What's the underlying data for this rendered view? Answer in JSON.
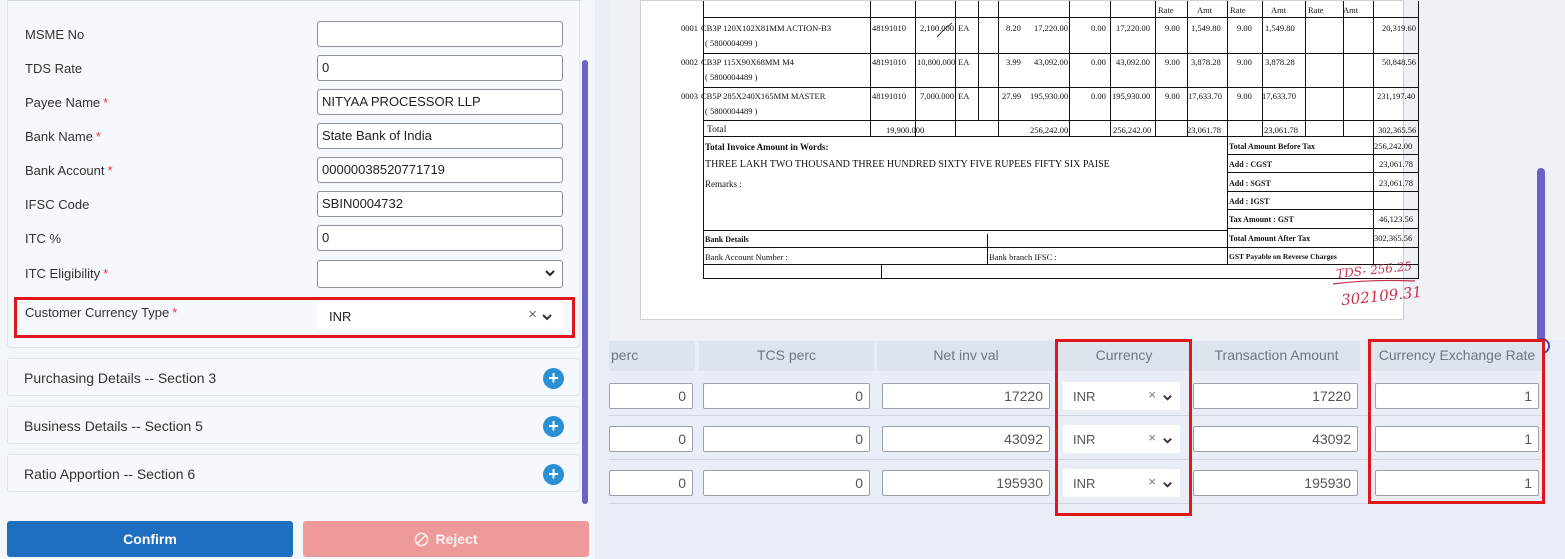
{
  "form": {
    "fields": [
      {
        "label": "MSME No",
        "value": "",
        "required": false
      },
      {
        "label": "TDS Rate",
        "value": "0",
        "required": false
      },
      {
        "label": "Payee Name",
        "value": "NITYAA PROCESSOR LLP",
        "required": true
      },
      {
        "label": "Bank Name",
        "value": "State Bank of India",
        "required": true
      },
      {
        "label": "Bank Account",
        "value": "00000038520771719",
        "required": true
      },
      {
        "label": "IFSC Code",
        "value": "SBIN0004732",
        "required": false
      },
      {
        "label": "ITC %",
        "value": "0",
        "required": false
      },
      {
        "label": "ITC Eligibility",
        "value": "",
        "required": true
      }
    ],
    "currency_type": {
      "label": "Customer Currency Type",
      "value": "INR",
      "clear": "×"
    },
    "required_mark": "*"
  },
  "sections": [
    {
      "title": "Purchasing Details -- Section 3"
    },
    {
      "title": "Business Details -- Section 5"
    },
    {
      "title": "Ratio Apportion -- Section 6"
    }
  ],
  "actions": {
    "confirm": "Confirm",
    "reject": "Reject"
  },
  "invoice": {
    "header_cols": [
      "Rate",
      "Amt",
      "Rate",
      "Amt",
      "Rate",
      "Amt"
    ],
    "lines": [
      {
        "sno": "0001",
        "desc": "CB3P 120X102X81MM ACTION-B3",
        "code": "( 5800004099 )",
        "hsn": "48191010",
        "qty": "2,100.000",
        "unit": "EA",
        "rate": "8.20",
        "amount": "17,220.00",
        "disc": "0.00",
        "taxable": "17,220.00",
        "cgst_rate": "9.00",
        "cgst_amt": "1,549.80",
        "sgst_rate": "9.00",
        "sgst_amt": "1,549.80",
        "total": "20,319.60"
      },
      {
        "sno": "0002",
        "desc": "CB3P 115X90X68MM M4",
        "code": "( 5800004489 )",
        "hsn": "48191010",
        "qty": "10,800.000",
        "unit": "EA",
        "rate": "3.99",
        "amount": "43,092.00",
        "disc": "0.00",
        "taxable": "43,092.00",
        "cgst_rate": "9.00",
        "cgst_amt": "3,878.28",
        "sgst_rate": "9.00",
        "sgst_amt": "3,878.28",
        "total": "50,848.56"
      },
      {
        "sno": "0003",
        "desc": "CB5P 285X240X165MM MASTER",
        "code": "( 5800004489 )",
        "hsn": "48191010",
        "qty": "7,000.000",
        "unit": "EA",
        "rate": "27.99",
        "amount": "195,930.00",
        "disc": "0.00",
        "taxable": "195,930.00",
        "cgst_rate": "9.00",
        "cgst_amt": "17,633.70",
        "sgst_rate": "9.00",
        "sgst_amt": "17,633.70",
        "total": "231,197.40"
      }
    ],
    "total_row": {
      "label": "Total",
      "qty": "19,900.000",
      "amount": "256,242.00",
      "taxable": "256,242.00",
      "cgst_amt": "23,061.78",
      "sgst_amt": "23,061.78",
      "total": "302,365.56"
    },
    "words_label": "Total Invoice Amount in Words:",
    "words_value": "THREE LAKH TWO THOUSAND THREE HUNDRED SIXTY FIVE RUPEES FIFTY SIX PAISE",
    "remarks_label": "Remarks :",
    "bank_details": "Bank Details",
    "bank_account": "Bank Account Number :",
    "bank_ifsc": "Bank branch IFSC :",
    "summary": [
      {
        "label": "Total Amount Before Tax",
        "value": "256,242.00"
      },
      {
        "label": "Add : CGST",
        "value": "23,061.78"
      },
      {
        "label": "Add : SGST",
        "value": "23,061.78"
      },
      {
        "label": "Add : IGST",
        "value": ""
      },
      {
        "label": "Tax Amount : GST",
        "value": "46,123.56"
      },
      {
        "label": "Total Amount After Tax",
        "value": "302,365.56"
      },
      {
        "label": "GST Payable on Reverse Charges",
        "value": ""
      }
    ],
    "handwritten_tds": "TDS- 256.25",
    "handwritten_net": "302109.31"
  },
  "grid": {
    "columns": [
      "perc",
      "TCS perc",
      "Net inv val",
      "Currency",
      "Transaction Amount",
      "Currency Exchange Rate"
    ],
    "rows": [
      {
        "perc": "0",
        "tcs": "0",
        "net": "17220",
        "currency": "INR",
        "txn": "17220",
        "rate": "1"
      },
      {
        "perc": "0",
        "tcs": "0",
        "net": "43092",
        "currency": "INR",
        "txn": "43092",
        "rate": "1"
      },
      {
        "perc": "0",
        "tcs": "0",
        "net": "195930",
        "currency": "INR",
        "txn": "195930",
        "rate": "1"
      }
    ],
    "clear": "×"
  },
  "colors": {
    "highlight": "#e0161e",
    "primary": "#1e6ec2",
    "reject": "#ef9a9a",
    "scroll": "#6a62c8"
  }
}
